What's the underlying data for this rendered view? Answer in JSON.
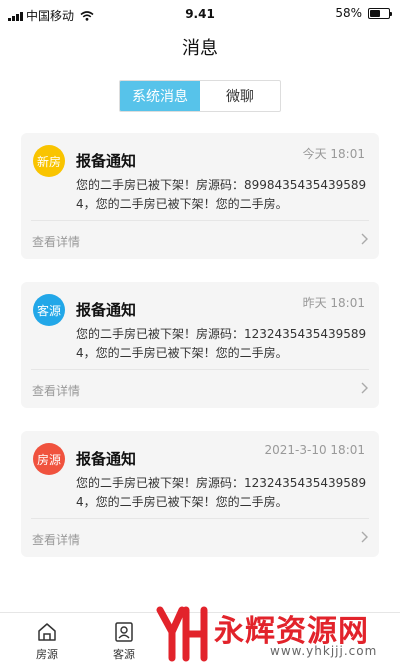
{
  "status_bar": {
    "carrier": "中国移动",
    "time": "9.41",
    "battery": "58%",
    "battery_level": 0.58
  },
  "page_title": "消息",
  "segments": [
    {
      "label": "系统消息",
      "active": true
    },
    {
      "label": "微聊",
      "active": false
    }
  ],
  "messages": [
    {
      "badge": "新房",
      "badge_color": "#f9c400",
      "title": "报备通知",
      "time": "今天 18:01",
      "text": "您的二手房已被下架！房源码：89984354354395894，您的二手房已被下架！您的二手房。",
      "detail_label": "查看详情"
    },
    {
      "badge": "客源",
      "badge_color": "#22a7e8",
      "title": "报备通知",
      "time": "昨天 18:01",
      "text": "您的二手房已被下架！房源码：12324354354395894，您的二手房已被下架！您的二手房。",
      "detail_label": "查看详情"
    },
    {
      "badge": "房源",
      "badge_color": "#f0523e",
      "title": "报备通知",
      "time": "2021-3-10 18:01",
      "text": "您的二手房已被下架！房源码：12324354354395894，您的二手房已被下架！您的二手房。",
      "detail_label": "查看详情"
    }
  ],
  "tab_bar": [
    {
      "label": "房源",
      "icon": "home-icon"
    },
    {
      "label": "客源",
      "icon": "contact-card-icon"
    }
  ],
  "watermark": {
    "logo_letters": "YH",
    "title": "永辉资源网",
    "url": "www.yhkjjj.com"
  }
}
